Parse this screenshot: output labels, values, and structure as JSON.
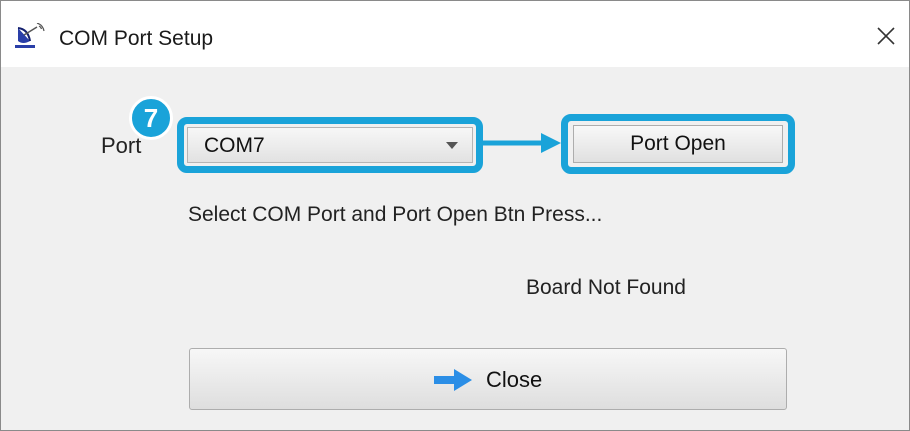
{
  "window": {
    "title": "COM Port Setup",
    "app_icon": "satellite-dish-icon",
    "close_icon": "close-icon"
  },
  "form": {
    "port_label": "Port",
    "port_selected": "COM7",
    "port_open_label": "Port Open",
    "instruction": "Select COM Port and Port Open Btn Press...",
    "board_status": "Board Not Found",
    "close_label": "Close",
    "close_icon": "right-arrow-icon"
  },
  "annotation": {
    "step_number": "7",
    "highlight_color": "#1aa3d9"
  },
  "colors": {
    "arrow_blue": "#2b8ee6",
    "highlight": "#1aa3d9"
  }
}
